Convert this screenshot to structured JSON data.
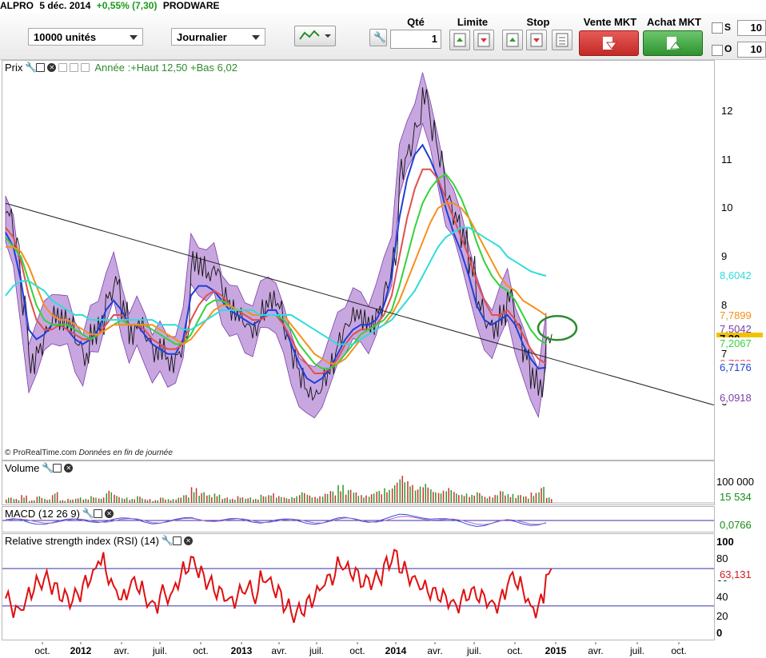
{
  "title": {
    "symbol": "ALPRO",
    "date": "5 déc. 2014",
    "change": "+0,55% (7,30)",
    "exchange": "PRODWARE"
  },
  "toolbar": {
    "quantity_select": "10000 unités",
    "period_select": "Journalier",
    "qte_label": "Qté",
    "qte_value": "1",
    "limite_label": "Limite",
    "stop_label": "Stop",
    "sell_label": "Vente MKT",
    "buy_label": "Achat MKT",
    "s_label": "S",
    "o_label": "O",
    "s_value": "10",
    "o_value": "10",
    "colors": {
      "sell": "#d9302c",
      "buy": "#3fa63f"
    }
  },
  "price_panel": {
    "label": "Prix",
    "info": "Année :+Haut 12,50 +Bas 6,02",
    "footer": "© ProRealTime.com",
    "footer_note": "Données en fin de journée"
  },
  "volume_panel": {
    "label": "Volume",
    "ticks": [
      "100 000"
    ],
    "last": "15 534"
  },
  "macd_panel": {
    "label": "MACD (12 26 9)",
    "last": "0,0766"
  },
  "rsi_panel": {
    "label": "Relative strength index (RSI) (14)",
    "ticks": [
      "100",
      "80",
      "60",
      "40",
      "20",
      "0"
    ],
    "last": "63,131"
  },
  "chart_data": {
    "type": "line",
    "title": "",
    "ylim": [
      5.3,
      12.9
    ],
    "yticks": [
      6,
      7,
      8,
      9,
      10,
      11,
      12
    ],
    "x_labels": [
      "oct.",
      "2012",
      "avr.",
      "juil.",
      "oct.",
      "2013",
      "avr.",
      "juil.",
      "oct.",
      "2014",
      "avr.",
      "juil.",
      "oct.",
      "2015",
      "avr.",
      "juil.",
      "oct."
    ],
    "price_close": [
      9.9,
      9.3,
      8.0,
      6.8,
      7.1,
      7.5,
      7.8,
      7.7,
      7.6,
      7.2,
      6.9,
      7.4,
      7.6,
      8.2,
      8.5,
      7.9,
      7.4,
      7.6,
      7.3,
      7.0,
      7.1,
      6.8,
      7.0,
      7.4,
      8.9,
      8.8,
      8.6,
      8.7,
      8.2,
      7.9,
      7.8,
      7.6,
      7.5,
      7.9,
      8.1,
      8.0,
      7.4,
      6.9,
      6.5,
      6.2,
      6.2,
      6.5,
      6.8,
      7.3,
      7.6,
      7.8,
      7.7,
      7.6,
      7.9,
      8.4,
      9.0,
      10.8,
      11.2,
      11.7,
      12.3,
      11.6,
      11.0,
      10.2,
      9.8,
      9.4,
      8.8,
      8.0,
      7.6,
      7.5,
      7.8,
      8.2,
      7.6,
      7.0,
      6.5,
      6.3,
      7.3
    ],
    "series": [
      {
        "name": "",
        "color": "#1f3fd6",
        "values": [
          9.5,
          9.2,
          8.5,
          7.5,
          7.3,
          7.4,
          7.6,
          7.6,
          7.5,
          7.3,
          7.2,
          7.3,
          7.5,
          7.9,
          8.1,
          7.9,
          7.6,
          7.6,
          7.4,
          7.2,
          7.1,
          7.0,
          7.0,
          7.3,
          8.2,
          8.4,
          8.4,
          8.3,
          8.1,
          7.9,
          7.8,
          7.7,
          7.6,
          7.7,
          7.9,
          7.9,
          7.6,
          7.2,
          6.8,
          6.5,
          6.4,
          6.5,
          6.7,
          7.0,
          7.3,
          7.5,
          7.6,
          7.6,
          7.7,
          8.0,
          8.6,
          9.8,
          10.6,
          11.1,
          11.3,
          11.0,
          10.6,
          10.0,
          9.5,
          9.1,
          8.6,
          8.0,
          7.7,
          7.6,
          7.7,
          7.8,
          7.6,
          7.2,
          6.9,
          6.7,
          6.7176
        ]
      },
      {
        "name": "",
        "color": "#e05050",
        "values": [
          9.6,
          9.4,
          8.9,
          8.2,
          7.7,
          7.5,
          7.5,
          7.6,
          7.5,
          7.4,
          7.3,
          7.3,
          7.4,
          7.6,
          7.8,
          7.8,
          7.6,
          7.6,
          7.5,
          7.3,
          7.2,
          7.1,
          7.1,
          7.2,
          7.7,
          8.0,
          8.2,
          8.3,
          8.2,
          8.0,
          7.9,
          7.8,
          7.7,
          7.7,
          7.8,
          7.8,
          7.6,
          7.3,
          7.0,
          6.8,
          6.6,
          6.6,
          6.7,
          6.9,
          7.2,
          7.4,
          7.5,
          7.5,
          7.6,
          7.8,
          8.2,
          9.0,
          9.8,
          10.4,
          10.8,
          10.8,
          10.6,
          10.2,
          9.8,
          9.4,
          9.0,
          8.5,
          8.1,
          7.8,
          7.8,
          7.9,
          7.7,
          7.4,
          7.1,
          6.9,
          6.798
        ]
      },
      {
        "name": "",
        "color": "#34d23a",
        "values": [
          9.4,
          9.2,
          9.0,
          8.5,
          8.0,
          7.7,
          7.6,
          7.6,
          7.6,
          7.5,
          7.4,
          7.3,
          7.4,
          7.5,
          7.6,
          7.7,
          7.6,
          7.6,
          7.6,
          7.5,
          7.4,
          7.3,
          7.2,
          7.2,
          7.4,
          7.7,
          8.0,
          8.1,
          8.1,
          8.0,
          7.9,
          7.9,
          7.8,
          7.8,
          7.8,
          7.8,
          7.7,
          7.5,
          7.2,
          7.0,
          6.8,
          6.7,
          6.7,
          6.8,
          7.0,
          7.2,
          7.4,
          7.5,
          7.6,
          7.7,
          7.9,
          8.4,
          9.0,
          9.6,
          10.1,
          10.4,
          10.6,
          10.7,
          10.5,
          10.2,
          9.8,
          9.3,
          8.9,
          8.6,
          8.4,
          8.3,
          8.1,
          7.8,
          7.5,
          7.3,
          7.2067
        ]
      },
      {
        "name": "",
        "color": "#f5901e",
        "values": [
          9.2,
          9.2,
          9.1,
          8.8,
          8.4,
          8.0,
          7.8,
          7.7,
          7.7,
          7.6,
          7.5,
          7.4,
          7.4,
          7.5,
          7.6,
          7.6,
          7.6,
          7.6,
          7.6,
          7.6,
          7.5,
          7.4,
          7.3,
          7.2,
          7.3,
          7.5,
          7.7,
          7.9,
          8.0,
          8.0,
          7.9,
          7.9,
          7.8,
          7.8,
          7.8,
          7.8,
          7.8,
          7.6,
          7.4,
          7.2,
          7.0,
          6.9,
          6.8,
          6.8,
          6.9,
          7.1,
          7.3,
          7.4,
          7.5,
          7.6,
          7.8,
          8.1,
          8.5,
          8.9,
          9.3,
          9.7,
          10.0,
          10.1,
          10.1,
          10.0,
          9.8,
          9.5,
          9.2,
          8.9,
          8.6,
          8.4,
          8.3,
          8.1,
          8.0,
          7.9,
          7.7899
        ]
      },
      {
        "name": "",
        "color": "#2fdcdc",
        "values": [
          8.2,
          8.4,
          8.5,
          8.5,
          8.4,
          8.3,
          8.1,
          8.0,
          7.9,
          7.8,
          7.8,
          7.7,
          7.7,
          7.7,
          7.7,
          7.7,
          7.7,
          7.7,
          7.7,
          7.7,
          7.6,
          7.6,
          7.6,
          7.5,
          7.5,
          7.6,
          7.7,
          7.8,
          7.9,
          7.9,
          7.9,
          7.9,
          7.9,
          7.8,
          7.8,
          7.8,
          7.8,
          7.8,
          7.7,
          7.6,
          7.5,
          7.4,
          7.3,
          7.2,
          7.2,
          7.2,
          7.3,
          7.4,
          7.5,
          7.6,
          7.7,
          7.9,
          8.1,
          8.3,
          8.6,
          8.9,
          9.2,
          9.4,
          9.5,
          9.6,
          9.6,
          9.5,
          9.4,
          9.3,
          9.2,
          9.0,
          8.9,
          8.8,
          8.7,
          8.65,
          8.6042
        ]
      }
    ],
    "annotations": {
      "year_high": 12.5,
      "year_low": 6.02,
      "last_close": 7.3,
      "env_upper": 7.5042,
      "env_lower": 6.0918,
      "trendline": {
        "from": [
          0,
          10.1
        ],
        "to": [
          95,
          5.8
        ]
      }
    },
    "volume": [
      4,
      3,
      6,
      2,
      5,
      3,
      8,
      2,
      3,
      4,
      3,
      5,
      4,
      9,
      6,
      4,
      3,
      5,
      3,
      2,
      4,
      3,
      4,
      6,
      12,
      8,
      6,
      7,
      4,
      3,
      5,
      4,
      3,
      6,
      7,
      5,
      4,
      5,
      8,
      6,
      5,
      7,
      9,
      14,
      10,
      8,
      6,
      7,
      9,
      11,
      15,
      20,
      16,
      12,
      14,
      10,
      9,
      11,
      8,
      7,
      6,
      8,
      5,
      6,
      9,
      7,
      6,
      5,
      8,
      12,
      4
    ],
    "rsi": [
      38,
      25,
      30,
      45,
      55,
      60,
      50,
      40,
      35,
      42,
      55,
      65,
      80,
      60,
      45,
      40,
      55,
      50,
      35,
      30,
      45,
      40,
      55,
      70,
      78,
      65,
      55,
      45,
      40,
      35,
      45,
      50,
      40,
      60,
      55,
      45,
      30,
      20,
      25,
      35,
      45,
      55,
      60,
      75,
      70,
      65,
      55,
      55,
      60,
      75,
      85,
      70,
      60,
      55,
      50,
      45,
      40,
      35,
      30,
      40,
      45,
      40,
      35,
      30,
      40,
      60,
      55,
      40,
      25,
      35,
      63.131
    ]
  }
}
